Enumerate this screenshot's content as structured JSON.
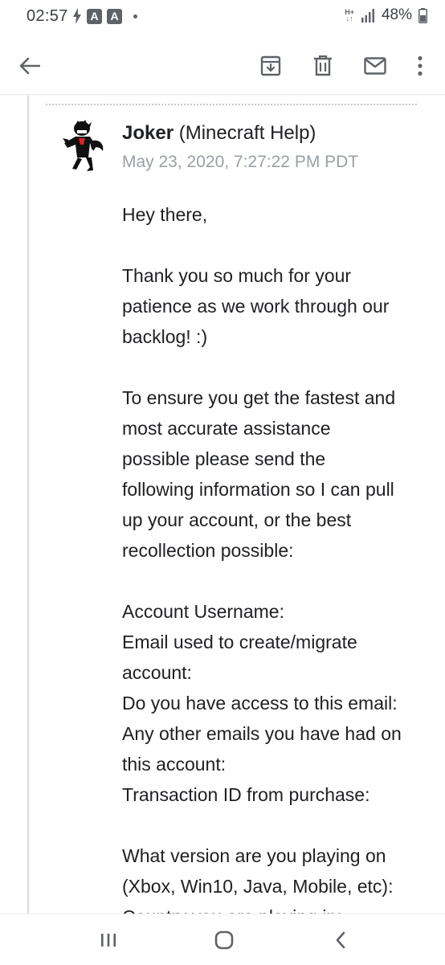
{
  "status_bar": {
    "time": "02:57",
    "badge_a": "A",
    "network_top": "H+",
    "network_bottom": "↓↑",
    "battery": "48%"
  },
  "toolbar": {
    "back_icon": "arrow-left-icon",
    "archive_icon": "archive-icon",
    "delete_icon": "trash-icon",
    "mark_unread_icon": "mail-icon",
    "more_icon": "more-vert-icon"
  },
  "message": {
    "sender_name": "Joker",
    "sender_suffix": " (Minecraft Help)",
    "date": "May 23, 2020, 7:27:22 PM PDT",
    "paragraphs": [
      "Hey there,",
      "Thank you so much for your\npatience as we work through our\nbacklog! :)",
      "To ensure you get the fastest and\nmost accurate assistance\npossible please send the\nfollowing information so I can pull\nup your account, or the best\nrecollection possible:",
      "Account Username:\nEmail used to create/migrate\naccount:\nDo you have access to this email:\nAny other emails you have had on\nthis account:\nTransaction ID from purchase:",
      "What version are you playing on\n(Xbox, Win10, Java, Mobile, etc):\nCountry you are playing in:"
    ]
  },
  "nav_bar": {
    "recents_icon": "recents-icon",
    "home_icon": "home-icon",
    "back_icon": "nav-back-icon"
  }
}
